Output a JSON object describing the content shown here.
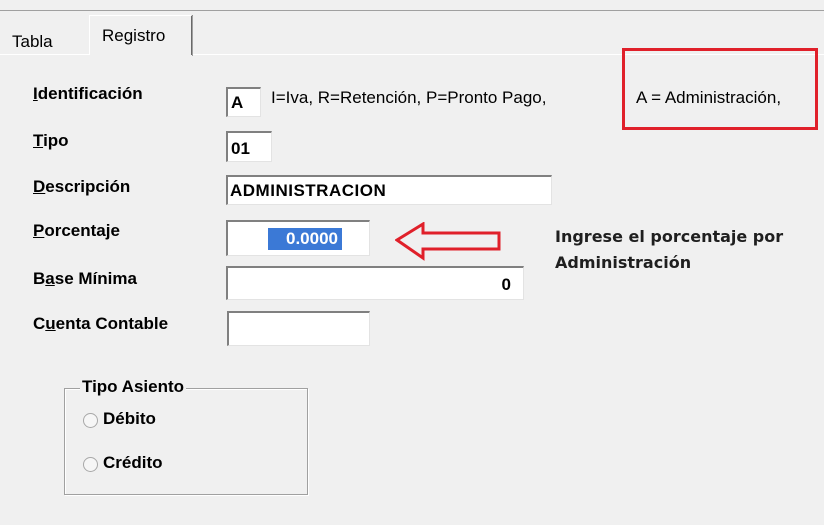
{
  "tabs": [
    {
      "label": "Tabla"
    },
    {
      "label": "Registro",
      "active": true
    }
  ],
  "form": {
    "identificacion": {
      "label": "Identificación",
      "mnemonic": "I",
      "value": "A",
      "hint": "I=Iva, R=Retención, P=Pronto Pago,",
      "hint_extra": "A = Administración,"
    },
    "tipo": {
      "label": "Tipo",
      "mnemonic": "T",
      "value": "01"
    },
    "descripcion": {
      "label": "Descripción",
      "mnemonic": "D",
      "value": "ADMINISTRACION"
    },
    "porcentaje": {
      "label": "Porcentaje",
      "mnemonic": "P",
      "value": "0.0000"
    },
    "base_minima": {
      "label": "Base Mínima",
      "mnemonic": "a",
      "value": "0"
    },
    "cuenta_contable": {
      "label": "Cuenta Contable",
      "mnemonic": "u",
      "value": ""
    }
  },
  "annotation": {
    "line1": "Ingrese el porcentaje por",
    "line2": "Administración",
    "highlight_color": "#e0202a"
  },
  "tipo_asiento": {
    "title": "Tipo Asiento",
    "options": [
      {
        "label": "Débito",
        "selected": false
      },
      {
        "label": "Crédito",
        "selected": false
      }
    ]
  }
}
